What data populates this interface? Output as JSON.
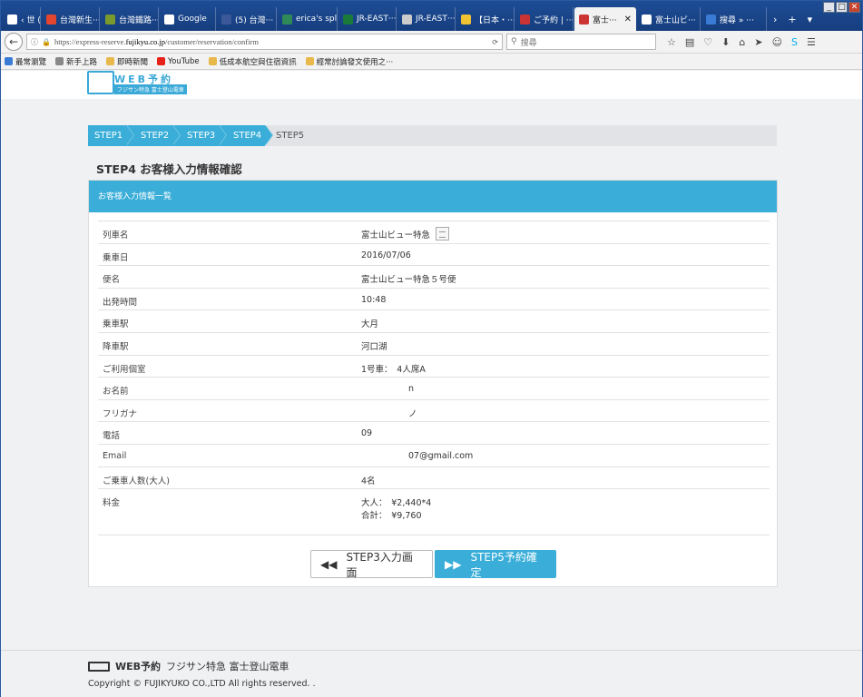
{
  "browser": {
    "tabs": [
      {
        "label": "‹ 世 (···",
        "color": "#ffffff"
      },
      {
        "label": "台灣新生···",
        "color": "#e3452f"
      },
      {
        "label": "台灣鐵路···",
        "color": "#7a9a2e"
      },
      {
        "label": "Google",
        "color": "#ffffff"
      },
      {
        "label": "(5) 台灣···",
        "color": "#3b5998"
      },
      {
        "label": "erica's spl···",
        "color": "#2e8b57"
      },
      {
        "label": "JR-EAST···",
        "color": "#1a7a3a"
      },
      {
        "label": "JR-EAST···",
        "color": "#cccccc"
      },
      {
        "label": "【日本・···",
        "color": "#f1c232"
      },
      {
        "label": "ご予約 | ···",
        "color": "#cc3333"
      },
      {
        "label": "富士···",
        "color": "#cc3333"
      },
      {
        "label": "富士山ビ···",
        "color": "#ffffff"
      },
      {
        "label": "搜尋 » ···",
        "color": "#3a7bd5"
      }
    ],
    "active_tab_index": 10,
    "url": "https://express-reserve.",
    "url_domain": "fujikyu.co.jp",
    "url_path": "/customer/reservation/confirm",
    "search_placeholder": "搜尋",
    "bookmarks": [
      {
        "label": "最常瀏覽",
        "color": "#3a7bd5"
      },
      {
        "label": "新手上路",
        "color": "#888888"
      },
      {
        "label": "即時新聞",
        "color": "#e8b84a"
      },
      {
        "label": "YouTube",
        "color": "#e62117"
      },
      {
        "label": "低成本航空與住宿資訊",
        "color": "#e8b84a"
      },
      {
        "label": "經常討論發文使用之···",
        "color": "#e8b84a"
      }
    ]
  },
  "site": {
    "logo_main": "WEB予約",
    "logo_sub": "フジサン特急 富士登山電車",
    "steps": [
      "STEP1",
      "STEP2",
      "STEP3",
      "STEP4",
      "STEP5"
    ],
    "page_title": "STEP4 お客様入力情報確認",
    "panel_title": "お客様入力情報一覧",
    "rows": [
      {
        "label": "列車名",
        "value": "富士山ビュー特急"
      },
      {
        "label": "乗車日",
        "value": "2016/07/06"
      },
      {
        "label": "便名",
        "value": "富士山ビュー特急５号便"
      },
      {
        "label": "出発時間",
        "value": "10:48"
      },
      {
        "label": "乗車駅",
        "value": "大月"
      },
      {
        "label": "降車駅",
        "value": "河口湖"
      },
      {
        "label": "ご利用個室",
        "value": "1号車：　4人席A"
      },
      {
        "label": "お名前",
        "value": "n"
      },
      {
        "label": "フリガナ",
        "value": "ノ"
      },
      {
        "label": "電話",
        "value": "09"
      },
      {
        "label": "Email",
        "value": "07@gmail.com"
      },
      {
        "label": "ご乗車人数(大人)",
        "value": "4名"
      },
      {
        "label": "料金",
        "value": "大人：　¥2,440*4",
        "value2": "合計：　¥9,760"
      }
    ],
    "back_button": "STEP3入力画面",
    "next_button": "STEP5予約確定",
    "footer_logo": "WEB予約",
    "footer_tagline": "フジサン特急 富士登山電車",
    "copyright": "Copyright © FUJIKYUKO CO.,LTD All rights reserved. ."
  }
}
